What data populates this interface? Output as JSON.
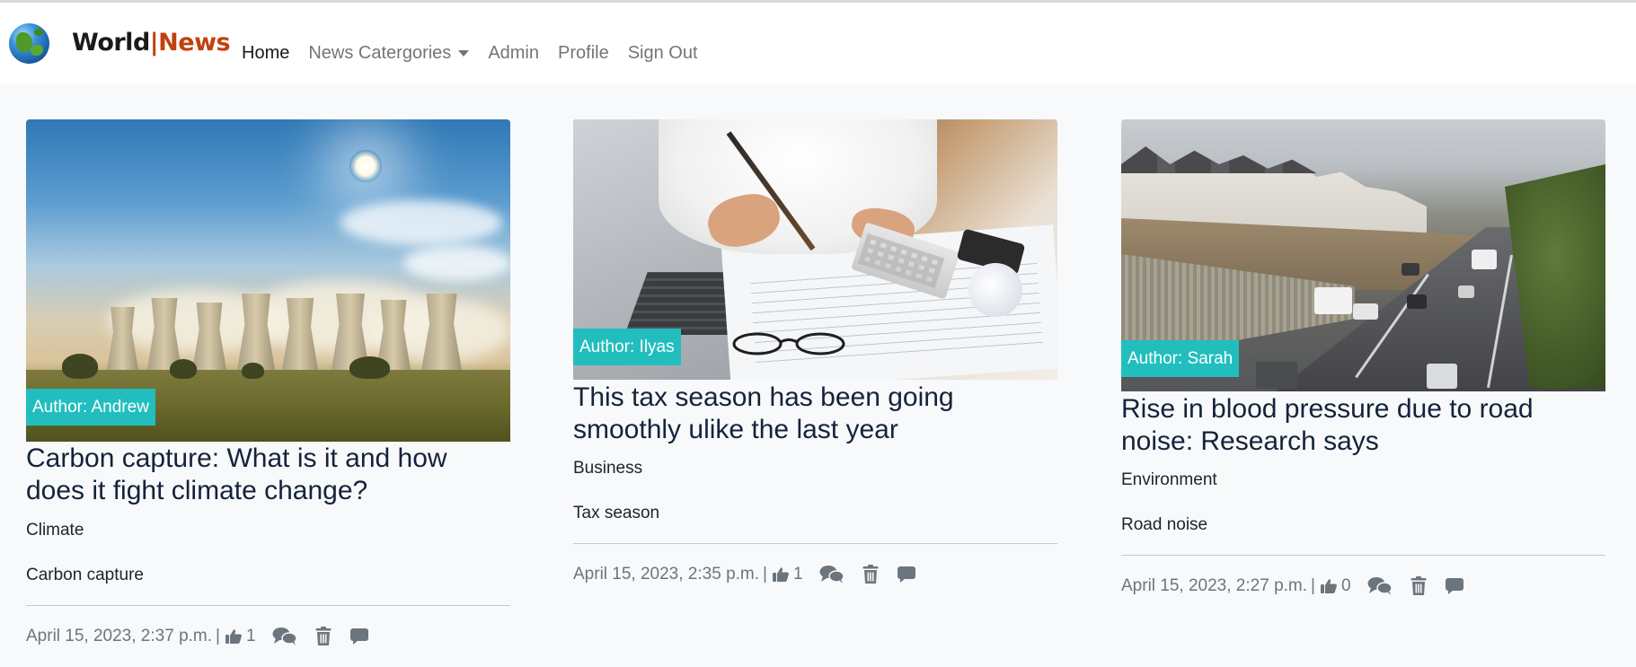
{
  "brand": {
    "world": "World",
    "separator": "|",
    "news": "News"
  },
  "nav": {
    "items": [
      {
        "label": "Home",
        "active": true
      },
      {
        "label": "News Catergories",
        "dropdown": true
      },
      {
        "label": "Admin"
      },
      {
        "label": "Profile"
      },
      {
        "label": "Sign Out"
      }
    ]
  },
  "colors": {
    "accent": "#22bebe",
    "brand_orange": "#c2410c",
    "title": "#15233b",
    "muted": "#6c757d"
  },
  "icons": [
    "globe-logo",
    "thumbs-up-icon",
    "comments-icon",
    "trash-icon",
    "comment-icon"
  ],
  "articles": [
    {
      "author": "Author: Andrew",
      "title": "Carbon capture: What is it and how does it fight climate change?",
      "category": "Climate",
      "tag": "Carbon capture",
      "date": "April 15, 2023, 2:37 p.m.",
      "separator": "|",
      "likes": "1"
    },
    {
      "author": "Author: Ilyas",
      "title": "This tax season has been going smoothly ulike the last year",
      "category": "Business",
      "tag": "Tax season",
      "date": "April 15, 2023, 2:35 p.m.",
      "separator": "|",
      "likes": "1"
    },
    {
      "author": "Author: Sarah",
      "title": "Rise in blood pressure due to road noise: Research says",
      "category": "Environment",
      "tag": "Road noise",
      "date": "April 15, 2023, 2:27 p.m.",
      "separator": "|",
      "likes": "0"
    }
  ]
}
